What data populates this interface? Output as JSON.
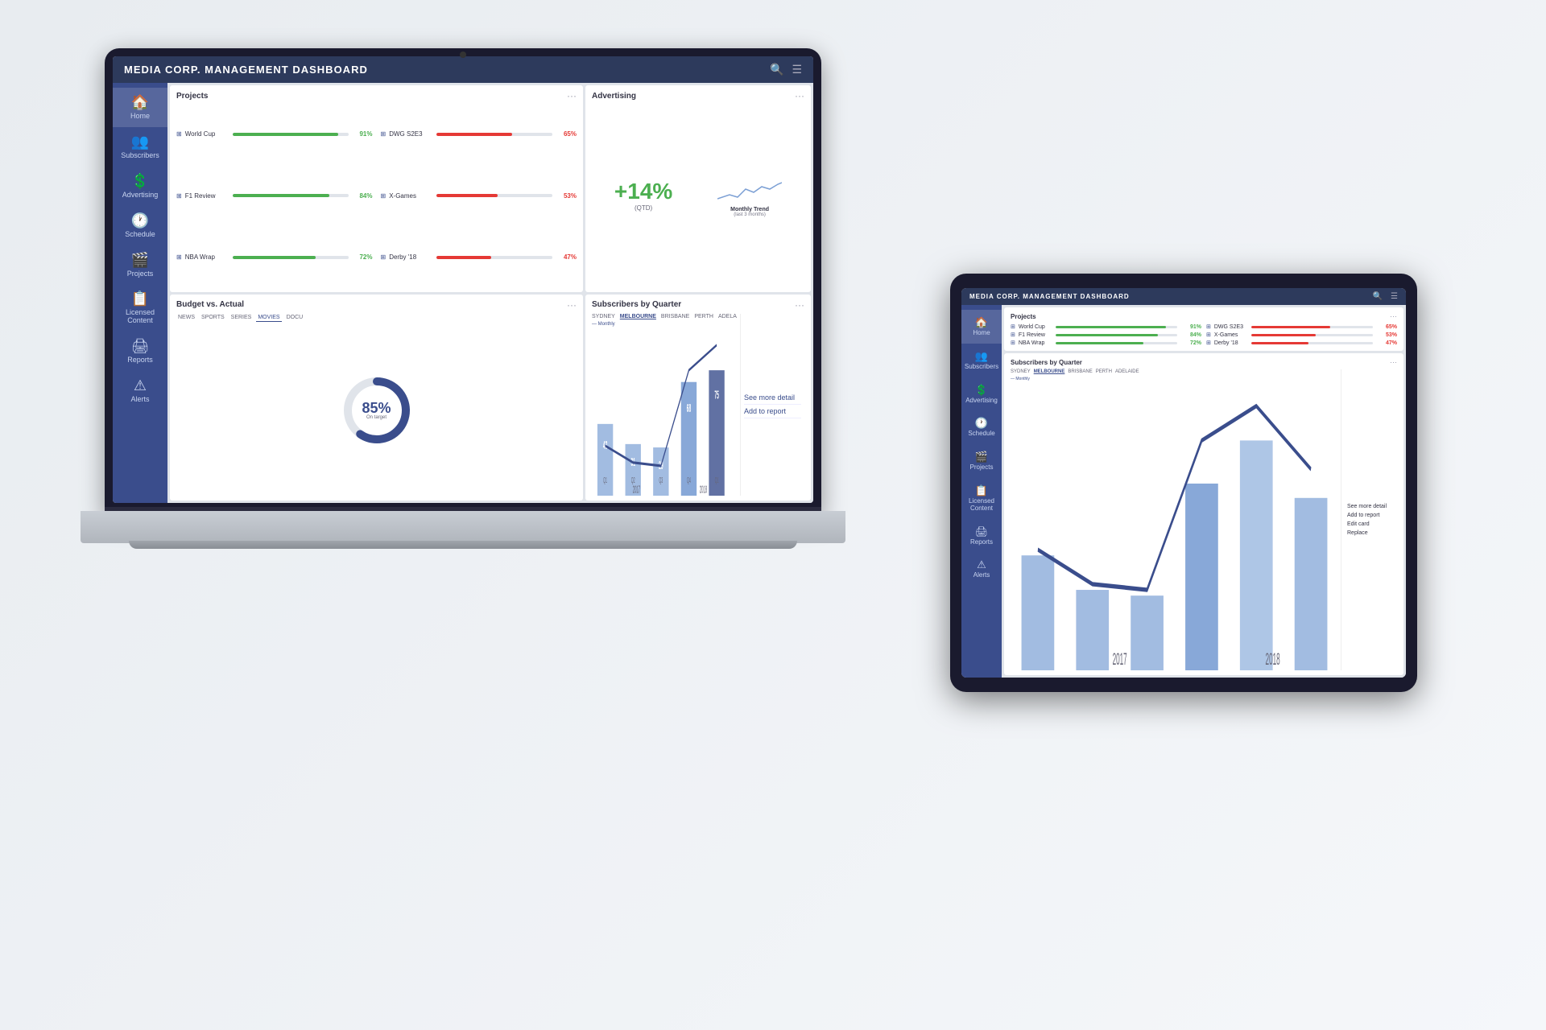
{
  "app": {
    "title": "MEDIA CORP. MANAGEMENT DASHBOARD"
  },
  "sidebar": {
    "items": [
      {
        "label": "Home",
        "icon": "🏠"
      },
      {
        "label": "Subscribers",
        "icon": "👥"
      },
      {
        "label": "Advertising",
        "icon": "💲"
      },
      {
        "label": "Schedule",
        "icon": "🕐"
      },
      {
        "label": "Projects",
        "icon": "🎬"
      },
      {
        "label": "Licensed\nContent",
        "icon": "📋"
      },
      {
        "label": "Reports",
        "icon": "🖨"
      },
      {
        "label": "Alerts",
        "icon": "⚠"
      }
    ]
  },
  "projects": {
    "title": "Projects",
    "items": [
      {
        "name": "World Cup",
        "pct": 91,
        "color": "green"
      },
      {
        "name": "F1 Review",
        "pct": 84,
        "color": "green"
      },
      {
        "name": "NBA Wrap",
        "pct": 72,
        "color": "green"
      },
      {
        "name": "DWG S2E3",
        "pct": 65,
        "color": "red"
      },
      {
        "name": "X-Games",
        "pct": 53,
        "color": "red"
      },
      {
        "name": "Derby '18",
        "pct": 47,
        "color": "red"
      }
    ]
  },
  "advertising": {
    "title": "Advertising",
    "value": "+14%",
    "label": "(QTD)",
    "trend_title": "Monthly Trend",
    "trend_sub": "(last 3 months)"
  },
  "budget": {
    "title": "Budget vs. Actual",
    "tabs": [
      "NEWS",
      "SPORTS",
      "SERIES",
      "MOVIES",
      "DOCU"
    ],
    "active_tab": "MOVIES",
    "pct": "85%",
    "sublabel": "On target"
  },
  "subscribers": {
    "title": "Subscribers by Quarter",
    "cities": [
      "SYDNEY",
      "MELBOURNE",
      "BRISBANE",
      "PERTH",
      "ADELAIDE"
    ],
    "active_city": "MELBOURNE",
    "monthly_label": "— Monthly",
    "bars": [
      43,
      31,
      29,
      68,
      75
    ],
    "years": [
      "2017",
      "2018"
    ],
    "quarters": [
      "Q1",
      "Q2",
      "Q3",
      "Q4",
      "Q1"
    ],
    "context_menu": [
      "See more detail",
      "Add to report"
    ],
    "context_menu_tablet": [
      "See more detail",
      "Add to report",
      "Edit card",
      "Replace"
    ]
  },
  "tablet": {
    "title": "MEDIA CORP. MANAGEMENT DASHBOARD",
    "projects_title": "Projects",
    "subscribers_title": "Subscribers by Quarter"
  }
}
